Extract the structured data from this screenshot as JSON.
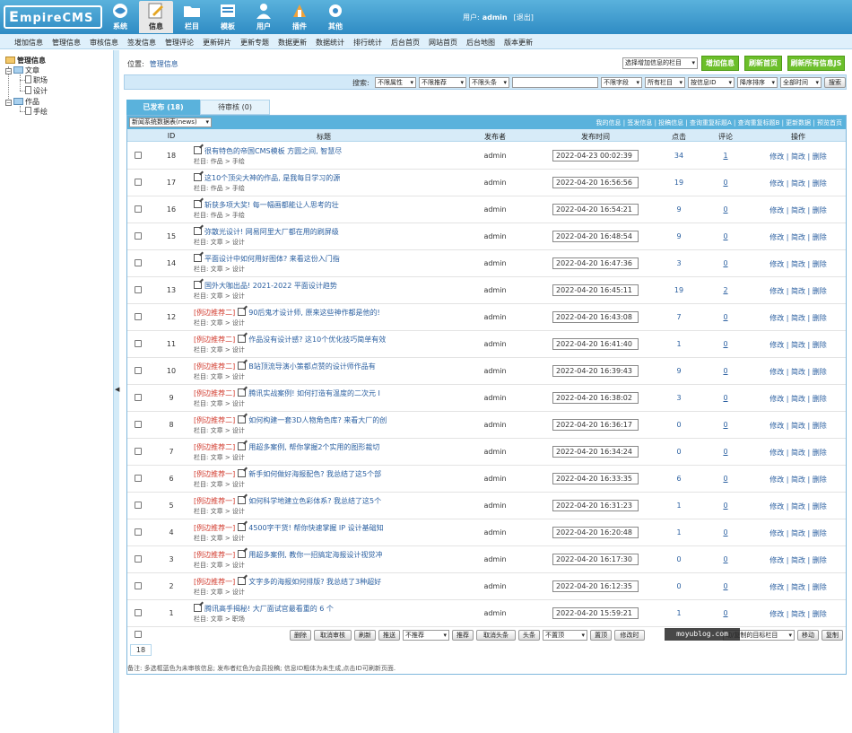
{
  "header": {
    "logo_main": "E",
    "logo_rest": "mpireCMS",
    "nav": [
      {
        "label": "系统",
        "icon": "system-icon"
      },
      {
        "label": "信息",
        "icon": "edit-icon",
        "active": true
      },
      {
        "label": "栏目",
        "icon": "folder-icon"
      },
      {
        "label": "模板",
        "icon": "template-icon"
      },
      {
        "label": "用户",
        "icon": "user-icon"
      },
      {
        "label": "插件",
        "icon": "plugin-icon"
      },
      {
        "label": "其他",
        "icon": "gear-icon"
      }
    ],
    "user_label": "用户:",
    "user_name": "admin",
    "logout": "[退出]"
  },
  "submenu": [
    "增加信息",
    "管理信息",
    "审核信息",
    "签发信息",
    "管理评论",
    "更新碎片",
    "更新专题",
    "数据更新",
    "数据统计",
    "排行统计",
    "后台首页",
    "网站首页",
    "后台地图",
    "版本更新"
  ],
  "sidebar": {
    "root": "管理信息",
    "nodes": [
      {
        "label": "文章",
        "children": [
          "职场",
          "设计"
        ]
      },
      {
        "label": "作品",
        "children": [
          "手绘"
        ]
      }
    ]
  },
  "location": {
    "label": "位置:",
    "link": "管理信息"
  },
  "top_actions": {
    "column_select": "选择增加信息的栏目",
    "add": "增加信息",
    "refresh_home": "刷新首页",
    "refresh_js": "刷新所有信息JS"
  },
  "search": {
    "label": "搜索:",
    "selects": [
      "不限属性",
      "不限推荐",
      "不限头条",
      "不限字段",
      "所有栏目",
      "按信息ID",
      "降序排序",
      "全部时间"
    ],
    "button": "搜索"
  },
  "tabs": {
    "published": "已发布 (18)",
    "pending": "待审核 (0)"
  },
  "table": {
    "table_select": "新闻系统数据表(news)",
    "top_links": "我的信息 | 签发信息 | 投稿信息 | 查询重复标题A | 查询重复标题B | 更新数据 | 预览首页",
    "headers": [
      "ID",
      "标题",
      "发布者",
      "发布时间",
      "点击",
      "评论",
      "操作"
    ],
    "col_prefix": "栏目:",
    "ops": "修改 | 简改 | 删除",
    "rows": [
      {
        "id": "18",
        "rec": "",
        "title": "很有特色的帝国CMS模板 方圆之间, 智慧尽",
        "column": "作品 > 手绘",
        "publisher": "admin",
        "time": "2022-04-23 00:02:39",
        "clicks": "34",
        "comments": "1"
      },
      {
        "id": "17",
        "rec": "",
        "title": "这10个顶尖大神的作品, 是我每日学习的源",
        "column": "作品 > 手绘",
        "publisher": "admin",
        "time": "2022-04-20 16:56:56",
        "clicks": "19",
        "comments": "0"
      },
      {
        "id": "16",
        "rec": "",
        "title": "斩获多项大奖! 每一幅画都能让人思考的壮",
        "column": "作品 > 手绘",
        "publisher": "admin",
        "time": "2022-04-20 16:54:21",
        "clicks": "9",
        "comments": "0"
      },
      {
        "id": "15",
        "rec": "",
        "title": "弥散光设计! 网易阿里大厂都在用的刷屏级",
        "column": "文章 > 设计",
        "publisher": "admin",
        "time": "2022-04-20 16:48:54",
        "clicks": "9",
        "comments": "0"
      },
      {
        "id": "14",
        "rec": "",
        "title": "平面设计中如何用好图体? 来看这份入门指",
        "column": "文章 > 设计",
        "publisher": "admin",
        "time": "2022-04-20 16:47:36",
        "clicks": "3",
        "comments": "0"
      },
      {
        "id": "13",
        "rec": "",
        "title": "国外大咖出品! 2021-2022 平面设计趋势",
        "column": "文章 > 设计",
        "publisher": "admin",
        "time": "2022-04-20 16:45:11",
        "clicks": "19",
        "comments": "2"
      },
      {
        "id": "12",
        "rec": "[例边推荐二]",
        "title": "90后鬼才设计师, 原来这些神作都是他的!",
        "column": "文章 > 设计",
        "publisher": "admin",
        "time": "2022-04-20 16:43:08",
        "clicks": "7",
        "comments": "0"
      },
      {
        "id": "11",
        "rec": "[例边推荐二]",
        "title": "作品没有设计感? 这10个优化技巧简单有效",
        "column": "文章 > 设计",
        "publisher": "admin",
        "time": "2022-04-20 16:41:40",
        "clicks": "1",
        "comments": "0"
      },
      {
        "id": "10",
        "rec": "[例边推荐二]",
        "title": "B站顶流导演小策都点赞的设计师作品有",
        "column": "文章 > 设计",
        "publisher": "admin",
        "time": "2022-04-20 16:39:43",
        "clicks": "9",
        "comments": "0"
      },
      {
        "id": "9",
        "rec": "[例边推荐二]",
        "title": "腾讯实战案例! 如何打造有温度的二次元 I",
        "column": "文章 > 设计",
        "publisher": "admin",
        "time": "2022-04-20 16:38:02",
        "clicks": "3",
        "comments": "0"
      },
      {
        "id": "8",
        "rec": "[例边推荐二]",
        "title": "如何构建一套3D人物角色库? 来看大厂的创",
        "column": "文章 > 设计",
        "publisher": "admin",
        "time": "2022-04-20 16:36:17",
        "clicks": "0",
        "comments": "0"
      },
      {
        "id": "7",
        "rec": "[例边推荐二]",
        "title": "用超多案例, 帮你掌握2个实用的图形裁切",
        "column": "文章 > 设计",
        "publisher": "admin",
        "time": "2022-04-20 16:34:24",
        "clicks": "0",
        "comments": "0"
      },
      {
        "id": "6",
        "rec": "[例边推荐一]",
        "title": "新手如何做好海报配色? 我总结了这5个部",
        "column": "文章 > 设计",
        "publisher": "admin",
        "time": "2022-04-20 16:33:35",
        "clicks": "6",
        "comments": "0"
      },
      {
        "id": "5",
        "rec": "[例边推荐一]",
        "title": "如何科学地建立色彩体系? 我总结了这5个",
        "column": "文章 > 设计",
        "publisher": "admin",
        "time": "2022-04-20 16:31:23",
        "clicks": "1",
        "comments": "0"
      },
      {
        "id": "4",
        "rec": "[例边推荐一]",
        "title": "4500字干货! 帮你快速掌握 IP 设计基础知",
        "column": "文章 > 设计",
        "publisher": "admin",
        "time": "2022-04-20 16:20:48",
        "clicks": "1",
        "comments": "0"
      },
      {
        "id": "3",
        "rec": "[例边推荐一]",
        "title": "用超多案例, 教你一招搞定海报设计视觉冲",
        "column": "文章 > 设计",
        "publisher": "admin",
        "time": "2022-04-20 16:17:30",
        "clicks": "0",
        "comments": "0"
      },
      {
        "id": "2",
        "rec": "[例边推荐一]",
        "title": "文字多的海报如何排版? 我总结了3种超好",
        "column": "文章 > 设计",
        "publisher": "admin",
        "time": "2022-04-20 16:12:35",
        "clicks": "0",
        "comments": "0"
      },
      {
        "id": "1",
        "rec": "",
        "title": "腾讯高手揭秘! 大厂面试官最看重的 6 个",
        "column": "文章 > 职场",
        "publisher": "admin",
        "time": "2022-04-20 15:59:21",
        "clicks": "1",
        "comments": "0"
      }
    ],
    "bottom": {
      "delete": "删除",
      "cancel_audit": "取消审核",
      "refresh": "刷新",
      "push": "推送",
      "rec_select": "不推荐",
      "recommend": "推荐",
      "cancel_headline": "取消头条",
      "headline": "头条",
      "top_select": "不置顶",
      "top": "置顶",
      "modify_time": "修改时",
      "target_select": "动/复制的目标栏目",
      "move": "移动",
      "copy": "复制"
    },
    "total": "18",
    "note": "备注: 多选框蓝色为未审核信息; 发布者红色为会员投稿; 信息ID粗体为未生成,点击ID可刷新页面."
  },
  "watermark": "moyublog.com"
}
